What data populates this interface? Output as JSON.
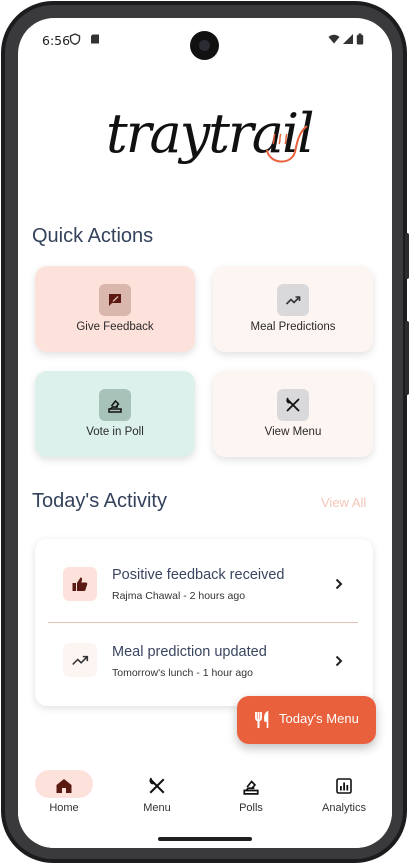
{
  "status_bar": {
    "time": "6:56"
  },
  "app": {
    "logo_text": "traytrail"
  },
  "quick_actions": {
    "title": "Quick Actions",
    "items": [
      {
        "label": "Give Feedback",
        "icon": "feedback-icon",
        "bg": "#fde2dc",
        "icon_bg": "#d9b7ad"
      },
      {
        "label": "Meal Predictions",
        "icon": "trending-up-icon",
        "bg": "#fdf5f2",
        "icon_bg": "#d9d9db"
      },
      {
        "label": "Vote in Poll",
        "icon": "ballot-icon",
        "bg": "#dcf1eb",
        "icon_bg": "#a7c3b9"
      },
      {
        "label": "View Menu",
        "icon": "fork-knife-icon",
        "bg": "#fdf5f2",
        "icon_bg": "#d9d9db"
      }
    ]
  },
  "activity": {
    "title": "Today's Activity",
    "view_all": "View All",
    "items": [
      {
        "title": "Positive feedback received",
        "subtitle": "Rajma Chawal - 2 hours ago",
        "icon": "thumbs-up-icon",
        "icon_bg": "#fde2dc"
      },
      {
        "title": "Meal prediction updated",
        "subtitle": "Tomorrow's lunch - 1 hour ago",
        "icon": "trending-up-icon",
        "icon_bg": "#fdf5f2"
      }
    ]
  },
  "fab": {
    "label": "Today's Menu",
    "icon": "restaurant-icon",
    "color": "#e8603c"
  },
  "bottom_nav": {
    "items": [
      {
        "label": "Home",
        "icon": "home-icon",
        "active": true
      },
      {
        "label": "Menu",
        "icon": "fork-knife-icon",
        "active": false
      },
      {
        "label": "Polls",
        "icon": "ballot-icon",
        "active": false
      },
      {
        "label": "Analytics",
        "icon": "analytics-icon",
        "active": false
      }
    ]
  },
  "colors": {
    "accent": "#e8603c",
    "heading": "#34425c",
    "nav_active_pill": "#fde2dc",
    "home_icon": "#5a1a12"
  }
}
